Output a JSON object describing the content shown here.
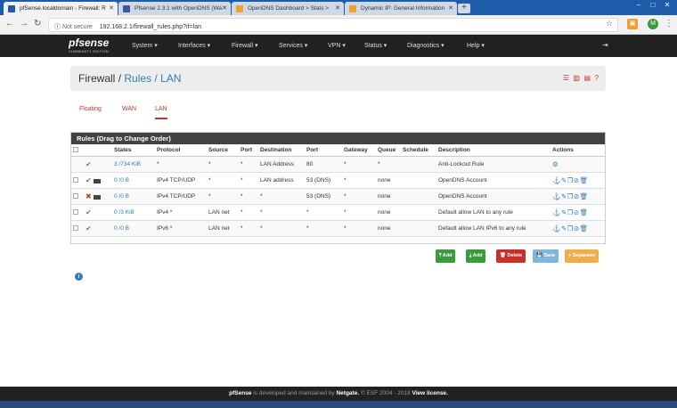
{
  "browser": {
    "tabs": [
      {
        "title": "pfSense.localdomain - Firewall: R",
        "favicon_color": "#1e5ba8"
      },
      {
        "title": "Pfsense 2.3.1 with OpenDNS (Wa",
        "favicon_color": "#3b5998"
      },
      {
        "title": "OpenDNS Dashboard > Stats >",
        "favicon_color": "#f0a030"
      },
      {
        "title": "Dynamic IP: General Information",
        "favicon_color": "#f0a030"
      }
    ],
    "security_label": "Not secure",
    "url": "192.168.2.1/firewall_rules.php?if=lan",
    "ext_label": "M"
  },
  "nav": {
    "logo": "pfsense",
    "logo_sub": "COMMUNITY EDITION",
    "menu": [
      "System ▾",
      "Interfaces ▾",
      "Firewall ▾",
      "Services ▾",
      "VPN ▾",
      "Status ▾",
      "Diagnostics ▾",
      "Help ▾"
    ]
  },
  "breadcrumb": {
    "root": "Firewall",
    "sep": "/",
    "mid": "Rules",
    "leaf": "LAN"
  },
  "subtabs": [
    "Floating",
    "WAN",
    "LAN"
  ],
  "panel_title": "Rules (Drag to Change Order)",
  "columns": [
    "",
    "",
    "States",
    "Protocol",
    "Source",
    "Port",
    "Destination",
    "Port",
    "Gateway",
    "Queue",
    "Schedule",
    "Description",
    "Actions"
  ],
  "rules": [
    {
      "status": "ok",
      "states": "3 /734 KiB",
      "protocol": "*",
      "source": "*",
      "sport": "*",
      "dest": "LAN Address",
      "dport": "80",
      "gateway": "*",
      "queue": "*",
      "schedule": "",
      "desc": "Anti-Lockout Rule"
    },
    {
      "status": "ok",
      "states": "0 /0 B",
      "protocol": "IPv4 TCP/UDP",
      "source": "*",
      "sport": "*",
      "dest": "LAN address",
      "dport": "53 (DNS)",
      "gateway": "*",
      "queue": "none",
      "schedule": "",
      "desc": "OpenDNS Account"
    },
    {
      "status": "block",
      "states": "0 /0 B",
      "protocol": "IPv4 TCP/UDP",
      "source": "*",
      "sport": "*",
      "dest": "*",
      "dport": "53 (DNS)",
      "gateway": "*",
      "queue": "none",
      "schedule": "",
      "desc": "OpenDNS Account"
    },
    {
      "status": "ok",
      "states": "0 /3 KiB",
      "protocol": "IPv4 *",
      "source": "LAN net",
      "sport": "*",
      "dest": "*",
      "dport": "*",
      "gateway": "*",
      "queue": "none",
      "schedule": "",
      "desc": "Default allow LAN to any rule"
    },
    {
      "status": "ok",
      "states": "0 /0 B",
      "protocol": "IPv6 *",
      "source": "LAN net",
      "sport": "*",
      "dest": "*",
      "dport": "*",
      "gateway": "*",
      "queue": "none",
      "schedule": "",
      "desc": "Default allow LAN IPv6 to any rule"
    }
  ],
  "buttons": {
    "add_top": "Add",
    "add_bottom": "Add",
    "delete": "Delete",
    "save": "Save",
    "separator": "Separator"
  },
  "footer": {
    "brand": "pfSense",
    "text1": " is developed and maintained by ",
    "netgate": "Netgate.",
    "text2": " © ESF 2004 - 2018 ",
    "license": "View license."
  },
  "colors": {
    "accent": "#c0392b",
    "link": "#337ab7",
    "success": "#3c9a3c",
    "danger": "#c9302c",
    "info": "#5bc0de",
    "warning": "#f0ad4e"
  }
}
